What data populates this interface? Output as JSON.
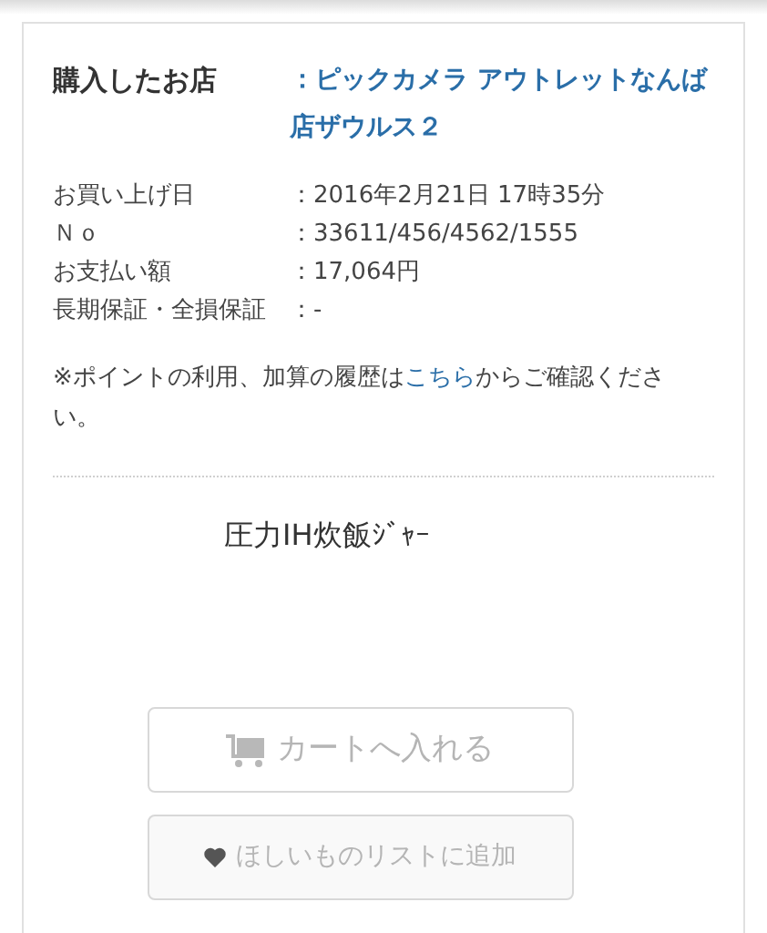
{
  "store": {
    "label": "購入したお店",
    "value": "：ピックカメラ アウトレットなんば店ザウルス２"
  },
  "details": [
    {
      "label": "お買い上げ日",
      "value": "：2016年2月21日 17時35分"
    },
    {
      "label": "Ｎｏ",
      "value": "：33611/456/4562/1555"
    },
    {
      "label": "お支払い額",
      "value": "：17,064円"
    },
    {
      "label": "長期保証・全損保証",
      "value": "：-"
    }
  ],
  "note": {
    "before": "※ポイントの利用、加算の履歴は",
    "link": "こちら",
    "after": "からご確認ください。"
  },
  "product": {
    "name": "圧力IH炊飯ｼﾞｬｰ"
  },
  "buttons": [
    {
      "kind": "cart",
      "label": "カートへ入れる",
      "disabled": true
    },
    {
      "kind": "wishlist",
      "label": "ほしいものリストに追加",
      "disabled": true
    }
  ]
}
